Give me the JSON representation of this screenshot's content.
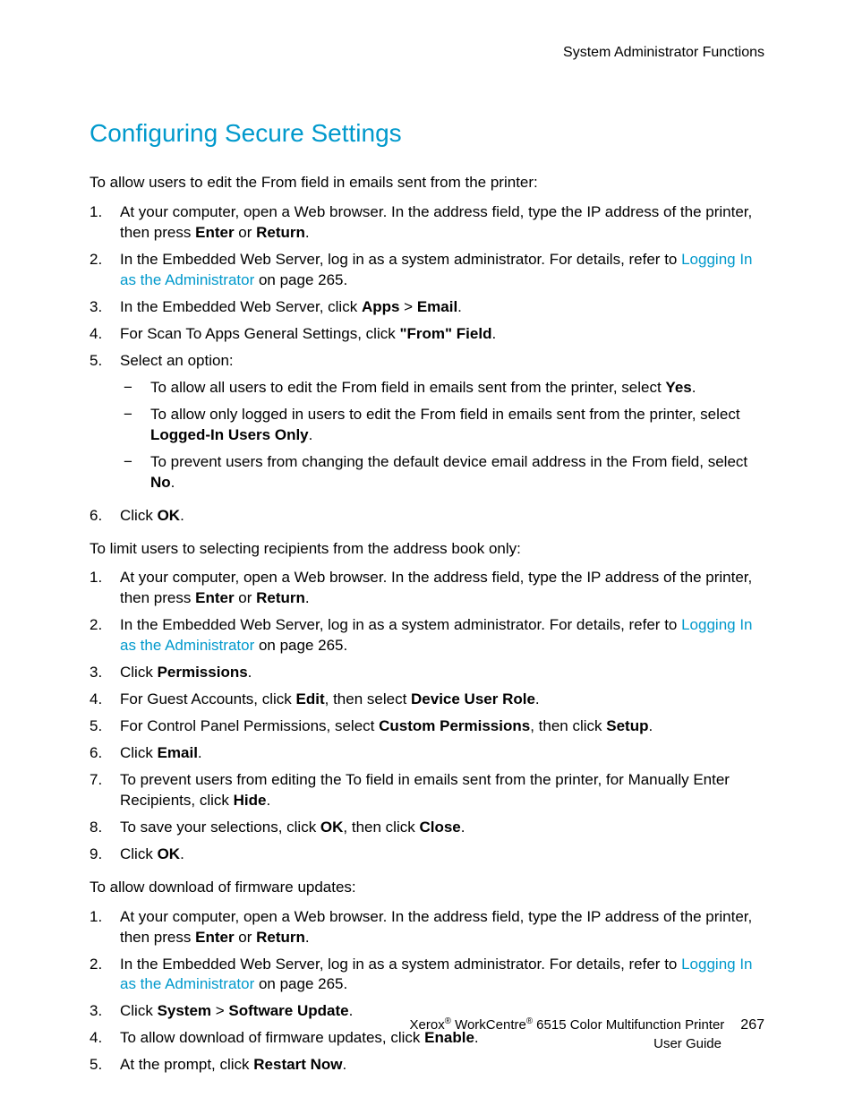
{
  "header": {
    "section": "System Administrator Functions"
  },
  "title": "Configuring Secure Settings",
  "sections": [
    {
      "intro": "To allow users to edit the From field in emails sent from the printer:",
      "items": [
        {
          "n": "1.",
          "pre": "At your computer, open a Web browser. In the address field, type the IP address of the printer, then press ",
          "b1": "Enter",
          "mid": " or ",
          "b2": "Return",
          "post": "."
        },
        {
          "n": "2.",
          "pre": "In the Embedded Web Server, log in as a system administrator. For details, refer to ",
          "link": "Logging In as the Administrator",
          "post2": " on page 265."
        },
        {
          "n": "3.",
          "pre": "In the Embedded Web Server, click ",
          "b1": "Apps",
          "mid": " > ",
          "b2": "Email",
          "post": "."
        },
        {
          "n": "4.",
          "pre": "For Scan To Apps General Settings, click ",
          "b1": "\"From\" Field",
          "post": "."
        },
        {
          "n": "5.",
          "plain": "Select an option:",
          "subs": [
            {
              "pre": "To allow all users to edit the From field in emails sent from the printer, select ",
              "b1": "Yes",
              "post": "."
            },
            {
              "pre": "To allow only logged in users to edit the From field in emails sent from the printer, select ",
              "b1": "Logged-In Users Only",
              "post": "."
            },
            {
              "pre": "To prevent users from changing the default device email address in the From field, select ",
              "b1": "No",
              "post": "."
            }
          ]
        },
        {
          "n": "6.",
          "pre": "Click ",
          "b1": "OK",
          "post": "."
        }
      ]
    },
    {
      "intro": "To limit users to selecting recipients from the address book only:",
      "items": [
        {
          "n": "1.",
          "pre": "At your computer, open a Web browser. In the address field, type the IP address of the printer, then press ",
          "b1": "Enter",
          "mid": " or ",
          "b2": "Return",
          "post": "."
        },
        {
          "n": "2.",
          "pre": "In the Embedded Web Server, log in as a system administrator. For details, refer to ",
          "link": "Logging In as the Administrator",
          "post2": " on page 265."
        },
        {
          "n": "3.",
          "pre": "Click ",
          "b1": "Permissions",
          "post": "."
        },
        {
          "n": "4.",
          "pre": "For Guest Accounts, click ",
          "b1": "Edit",
          "mid": ", then select ",
          "b2": "Device User Role",
          "post": "."
        },
        {
          "n": "5.",
          "pre": "For Control Panel Permissions, select ",
          "b1": "Custom Permissions",
          "mid": ", then click ",
          "b2": "Setup",
          "post": "."
        },
        {
          "n": "6.",
          "pre": "Click ",
          "b1": "Email",
          "post": "."
        },
        {
          "n": "7.",
          "pre": "To prevent users from editing the To field in emails sent from the printer, for Manually Enter Recipients, click ",
          "b1": "Hide",
          "post": "."
        },
        {
          "n": "8.",
          "pre": "To save your selections, click ",
          "b1": "OK",
          "mid": ", then click ",
          "b2": "Close",
          "post": "."
        },
        {
          "n": "9.",
          "pre": "Click ",
          "b1": "OK",
          "post": "."
        }
      ]
    },
    {
      "intro": "To allow download of firmware updates:",
      "items": [
        {
          "n": "1.",
          "pre": "At your computer, open a Web browser. In the address field, type the IP address of the printer, then press ",
          "b1": "Enter",
          "mid": " or ",
          "b2": "Return",
          "post": "."
        },
        {
          "n": "2.",
          "pre": "In the Embedded Web Server, log in as a system administrator. For details, refer to ",
          "link": "Logging In as the Administrator",
          "post2": " on page 265."
        },
        {
          "n": "3.",
          "pre": "Click ",
          "b1": "System",
          "mid": " > ",
          "b2": "Software Update",
          "post": "."
        },
        {
          "n": "4.",
          "pre": "To allow download of firmware updates, click ",
          "b1": "Enable",
          "post": "."
        },
        {
          "n": "5.",
          "pre": "At the prompt, click ",
          "b1": "Restart Now",
          "post": "."
        }
      ]
    }
  ],
  "footer": {
    "product_pre": "Xerox",
    "product_mid": " WorkCentre",
    "product_post": " 6515 Color Multifunction Printer",
    "sub": "User Guide",
    "page": "267"
  }
}
